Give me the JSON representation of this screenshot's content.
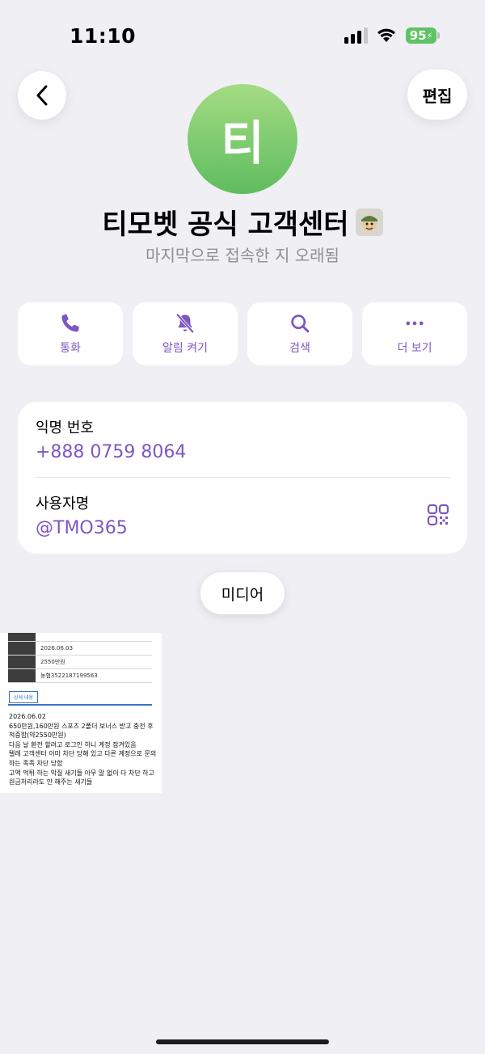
{
  "status_bar": {
    "time": "11:10",
    "battery": "95"
  },
  "header": {
    "edit_label": "편집",
    "avatar_initial": "티"
  },
  "profile": {
    "name": "티모벳 공식 고객센터",
    "subtitle": "마지막으로 접속한 지 오래됨"
  },
  "actions": [
    {
      "label": "통화",
      "icon": "phone-icon"
    },
    {
      "label": "알림 켜기",
      "icon": "bell-slash-icon"
    },
    {
      "label": "검색",
      "icon": "search-icon"
    },
    {
      "label": "더 보기",
      "icon": "more-icon"
    }
  ],
  "info": {
    "phone_label": "익명 번호",
    "phone_value": "+888 0759 8064",
    "username_label": "사용자명",
    "username_value": "@TMO365"
  },
  "media": {
    "label": "미디어"
  },
  "thumbnail": {
    "rows": [
      {
        "key": "",
        "value": ""
      },
      {
        "key": "",
        "value": "2026.06.03"
      },
      {
        "key": "",
        "value": "2550만원"
      },
      {
        "key": "",
        "value": "농협3522187199563"
      }
    ],
    "tab_label": "상세 내용",
    "lines": [
      "2026.06.02",
      "650만원,160만원 스포츠 2폴더 보너스 받고 충전 후",
      "적중함(약2550만원)",
      "다음 날 환전 할려고 로그인 하니 계정 잠겨있음",
      "텔레 고객센터 이미 차단 당해 있고 다른 계정으로 문의",
      "하는 족족 차단 당함",
      "고액 먹튀 하는 악질 새기들 아무 말 없이 다 차단 하고",
      "원금처리라도 안 해주는 새기들"
    ]
  },
  "colors": {
    "accent": "#7e57c2",
    "background": "#efeff4",
    "avatar": "#6cc263",
    "battery": "#5dc464"
  }
}
